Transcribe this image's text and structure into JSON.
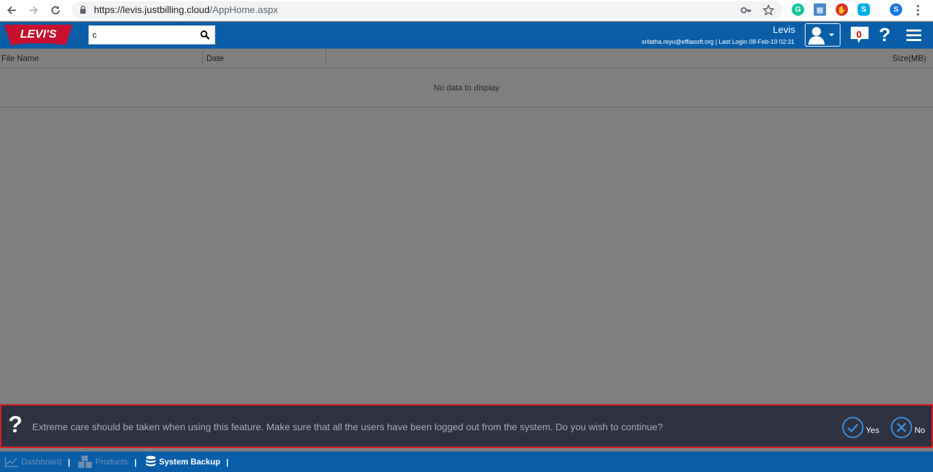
{
  "browser": {
    "url_host": "https://levis.justbilling.cloud",
    "url_path": "/AppHome.aspx"
  },
  "header": {
    "search_value": "c",
    "user_name": "Levis",
    "user_meta": "srilatha.reyu@effiasoft.org | Last Login 08-Feb-19 02:31",
    "notification_count": "0"
  },
  "grid": {
    "columns": [
      "File Name",
      "Date",
      "Size(MB)"
    ],
    "empty_text": "No data to display"
  },
  "confirm": {
    "message": "Extreme care should be taken when using this feature. Make sure that all the users have been logged out from the system. Do you wish to continue?",
    "yes_label": "Yes",
    "no_label": "No"
  },
  "footer": {
    "breadcrumbs": [
      "Dashboard",
      "Products",
      "System Backup"
    ],
    "separator": "|"
  },
  "colors": {
    "brand_blue": "#0a5ea8",
    "alert_border": "#e21b23",
    "dialog_bg": "#2e3240",
    "overlay_gray": "#7f7f7f"
  }
}
